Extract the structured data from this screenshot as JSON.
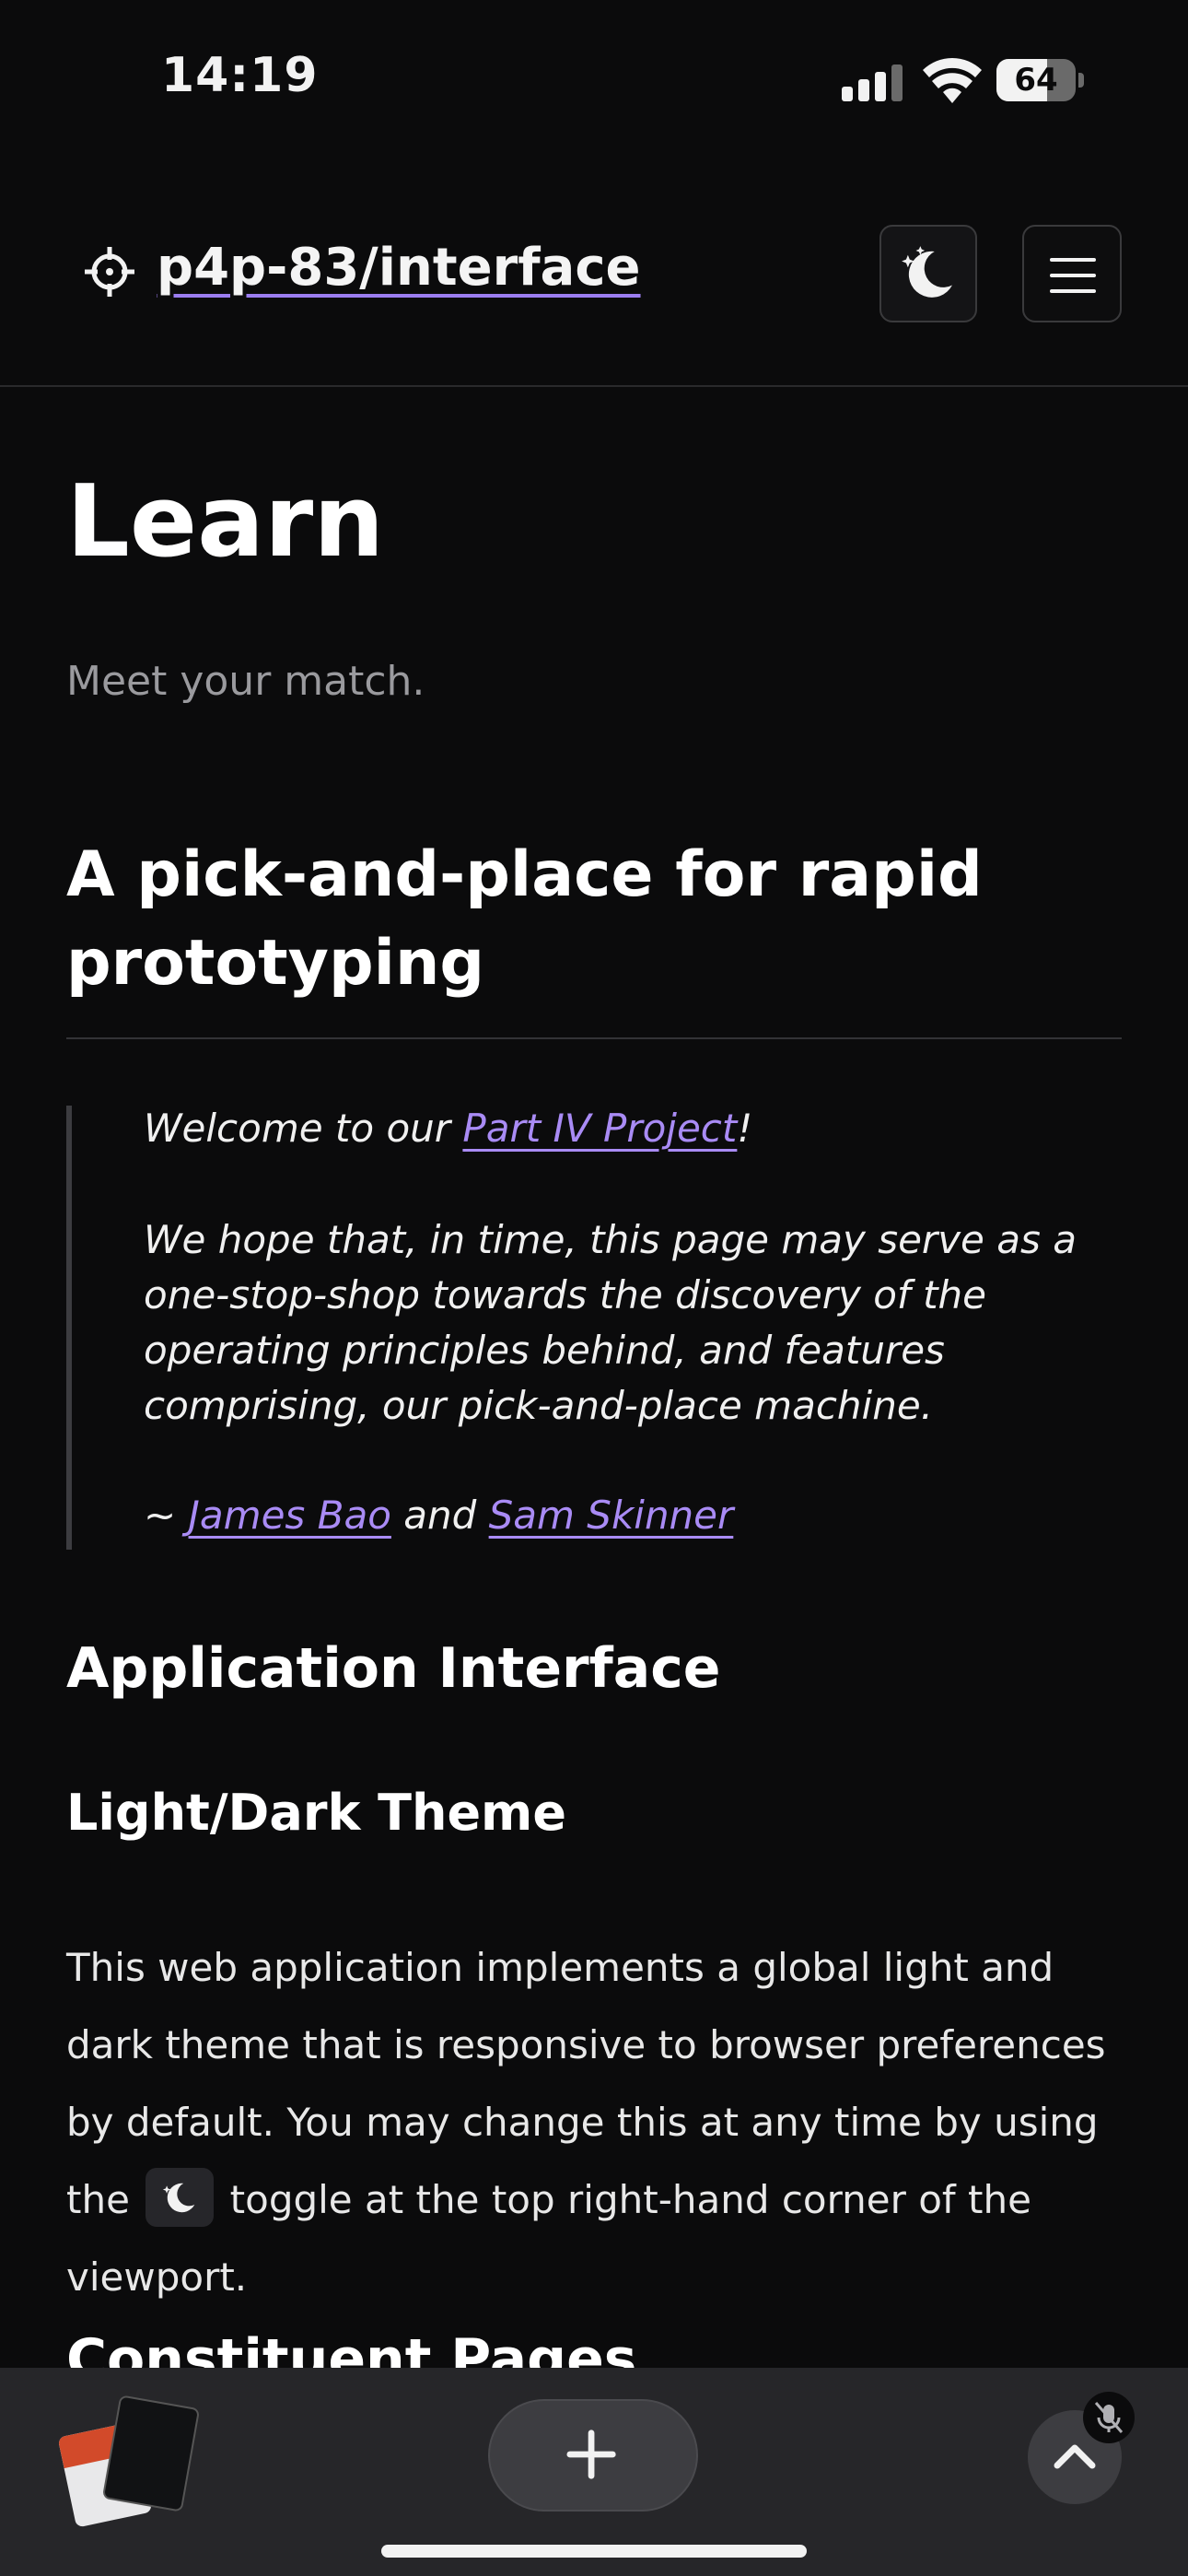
{
  "status_bar": {
    "time": "14:19",
    "battery_percent": "64",
    "battery_level": 0.64
  },
  "header": {
    "site_title": "p4p-83/interface"
  },
  "page": {
    "title": "Learn",
    "subtitle": "Meet your match.",
    "section_heading": "A pick-and-place for rapid prototyping",
    "quote": {
      "welcome_prefix": "Welcome to our ",
      "project_link": "Part IV Project",
      "welcome_suffix": "!",
      "paragraph": "We hope that, in time, this page may serve as a one-stop-shop towards the discovery of the operating principles behind, and features comprising, our pick-and-place machine.",
      "sign_prefix": "~ ",
      "author1": "James Bao",
      "and": " and ",
      "author2": "Sam Skinner"
    },
    "h2": "Application Interface",
    "h3": "Light/Dark Theme",
    "body_before": "This web application implements a global light and dark theme that is responsive to browser preferences by default. You may change this at any time by using the",
    "body_after": "toggle at the top right-hand corner of the viewport.",
    "next_heading": "Constituent Pages"
  },
  "colors": {
    "accent": "#a98bf5",
    "background": "#0b0b0c",
    "toolbar": "#262629"
  },
  "icons": [
    "crosshair-icon",
    "moon-stars-icon",
    "hamburger-icon",
    "plus-icon",
    "chevron-up-icon",
    "mic-off-icon"
  ]
}
